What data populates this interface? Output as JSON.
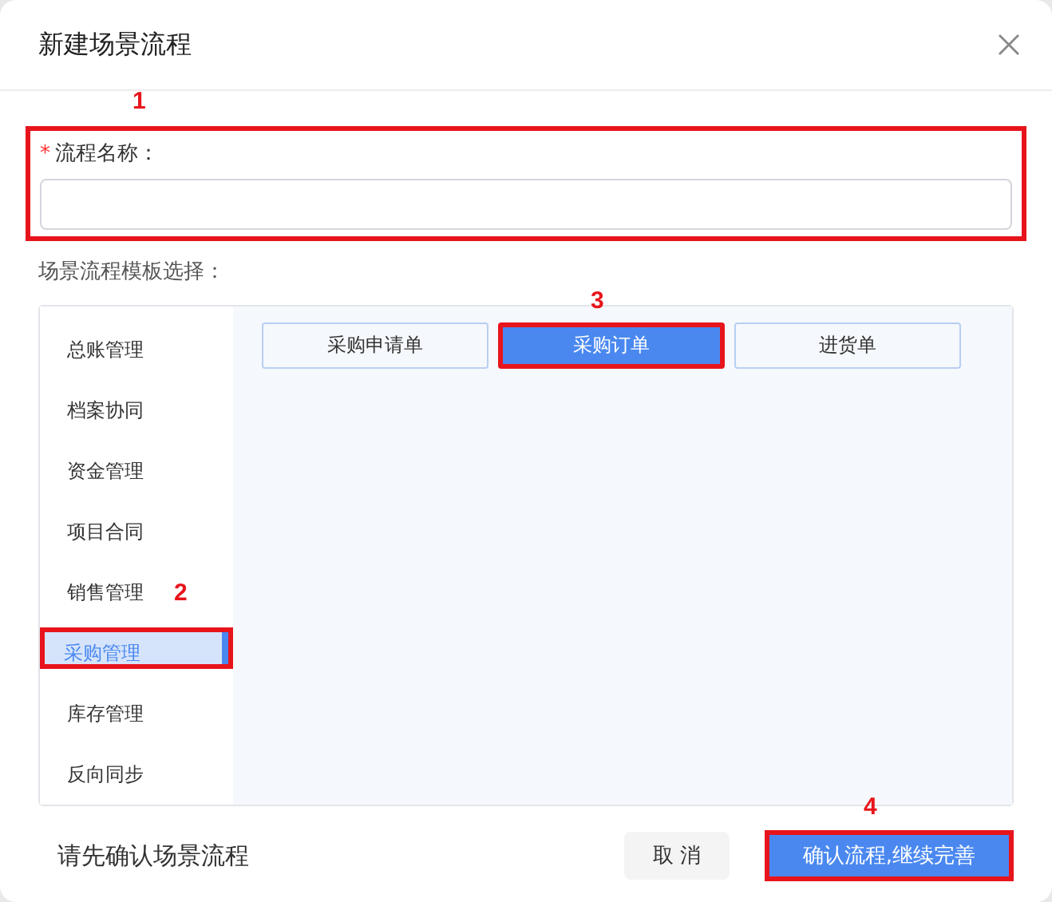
{
  "dialog": {
    "title": "新建场景流程"
  },
  "name_field": {
    "label": "流程名称：",
    "required_mark": "*",
    "annotation": "1"
  },
  "template_label": "场景流程模板选择：",
  "categories": [
    {
      "label": "总账管理",
      "selected": false
    },
    {
      "label": "档案协同",
      "selected": false
    },
    {
      "label": "资金管理",
      "selected": false
    },
    {
      "label": "项目合同",
      "selected": false
    },
    {
      "label": "销售管理",
      "selected": false
    },
    {
      "label": "采购管理",
      "selected": true,
      "annotation": "2"
    },
    {
      "label": "库存管理",
      "selected": false
    },
    {
      "label": "反向同步",
      "selected": false
    }
  ],
  "templates": [
    {
      "label": "采购申请单",
      "selected": false
    },
    {
      "label": "采购订单",
      "selected": true,
      "annotation": "3"
    },
    {
      "label": "进货单",
      "selected": false
    }
  ],
  "footer": {
    "hint": "请先确认场景流程",
    "cancel": "取 消",
    "confirm": "确认流程,继续完善",
    "confirm_annotation": "4"
  }
}
